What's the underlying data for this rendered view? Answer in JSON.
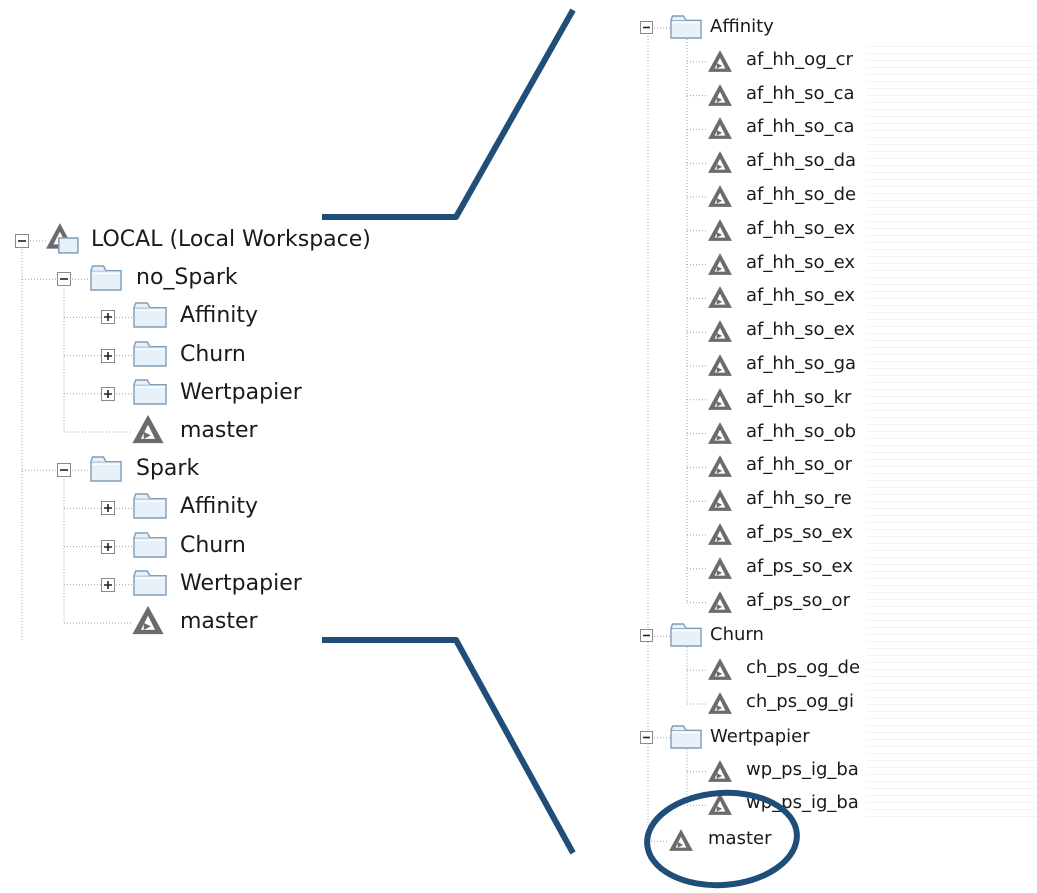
{
  "left_tree": {
    "root": {
      "label": "LOCAL (Local Workspace)",
      "icon": "workspace-icon",
      "toggle": "minus"
    },
    "groups": [
      {
        "label": "no_Spark",
        "icon": "folder-icon",
        "toggle": "minus",
        "children": [
          {
            "label": "Affinity",
            "icon": "folder-icon",
            "toggle": "plus"
          },
          {
            "label": "Churn",
            "icon": "folder-icon",
            "toggle": "plus"
          },
          {
            "label": "Wertpapier",
            "icon": "folder-icon",
            "toggle": "plus"
          },
          {
            "label": "master",
            "icon": "workflow-icon"
          }
        ]
      },
      {
        "label": "Spark",
        "icon": "folder-icon",
        "toggle": "minus",
        "children": [
          {
            "label": "Affinity",
            "icon": "folder-icon",
            "toggle": "plus"
          },
          {
            "label": "Churn",
            "icon": "folder-icon",
            "toggle": "plus"
          },
          {
            "label": "Wertpapier",
            "icon": "folder-icon",
            "toggle": "plus"
          },
          {
            "label": "master",
            "icon": "workflow-icon"
          }
        ]
      }
    ]
  },
  "right_tree": {
    "folders": [
      {
        "label": "Affinity",
        "icon": "folder-icon",
        "toggle": "minus",
        "items": [
          "af_hh_og_cr",
          "af_hh_so_ca",
          "af_hh_so_ca",
          "af_hh_so_da",
          "af_hh_so_de",
          "af_hh_so_ex",
          "af_hh_so_ex",
          "af_hh_so_ex",
          "af_hh_so_ex",
          "af_hh_so_ga",
          "af_hh_so_kr",
          "af_hh_so_ob",
          "af_hh_so_or",
          "af_hh_so_re",
          "af_ps_so_ex",
          "af_ps_so_ex",
          "af_ps_so_or"
        ]
      },
      {
        "label": "Churn",
        "icon": "folder-icon",
        "toggle": "minus",
        "items": [
          "ch_ps_og_de",
          "ch_ps_og_gi"
        ]
      },
      {
        "label": "Wertpapier",
        "icon": "folder-icon",
        "toggle": "minus",
        "items": [
          "wp_ps_ig_ba",
          "wp_ps_ig_ba"
        ]
      }
    ],
    "master": {
      "label": "master",
      "icon": "workflow-icon",
      "highlighted": true
    }
  },
  "colors": {
    "callout": "#1f4e79",
    "tree_line": "#a0a0a0",
    "folder_fill": "#e8f1fa",
    "folder_stroke": "#7f9db9",
    "workflow_icon": "#6b6b6b",
    "toggle_border": "#8a8a8a"
  }
}
